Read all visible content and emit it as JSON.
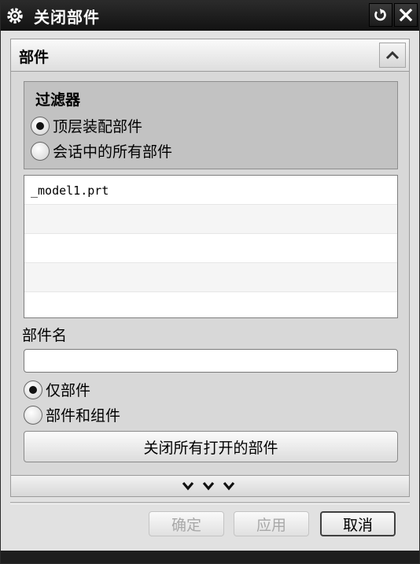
{
  "window": {
    "title": "关闭部件"
  },
  "icons": {
    "title_icon": "gear-icon",
    "reset_icon": "reset-icon",
    "close_icon": "close-icon",
    "collapse_icon": "chevron-up-icon",
    "more_icon": "chevron-down-icon"
  },
  "section": {
    "title": "部件"
  },
  "filter": {
    "title": "过滤器",
    "options": [
      {
        "label": "顶层装配部件",
        "selected": true
      },
      {
        "label": "会话中的所有部件",
        "selected": false
      }
    ]
  },
  "parts_list": {
    "rows": [
      "_model1.prt",
      "",
      "",
      "",
      ""
    ]
  },
  "part_name": {
    "label": "部件名",
    "value": ""
  },
  "scope": {
    "options": [
      {
        "label": "仅部件",
        "selected": true
      },
      {
        "label": "部件和组件",
        "selected": false
      }
    ]
  },
  "close_all_button": "关闭所有打开的部件",
  "footer": {
    "ok": "确定",
    "apply": "应用",
    "cancel": "取消"
  }
}
